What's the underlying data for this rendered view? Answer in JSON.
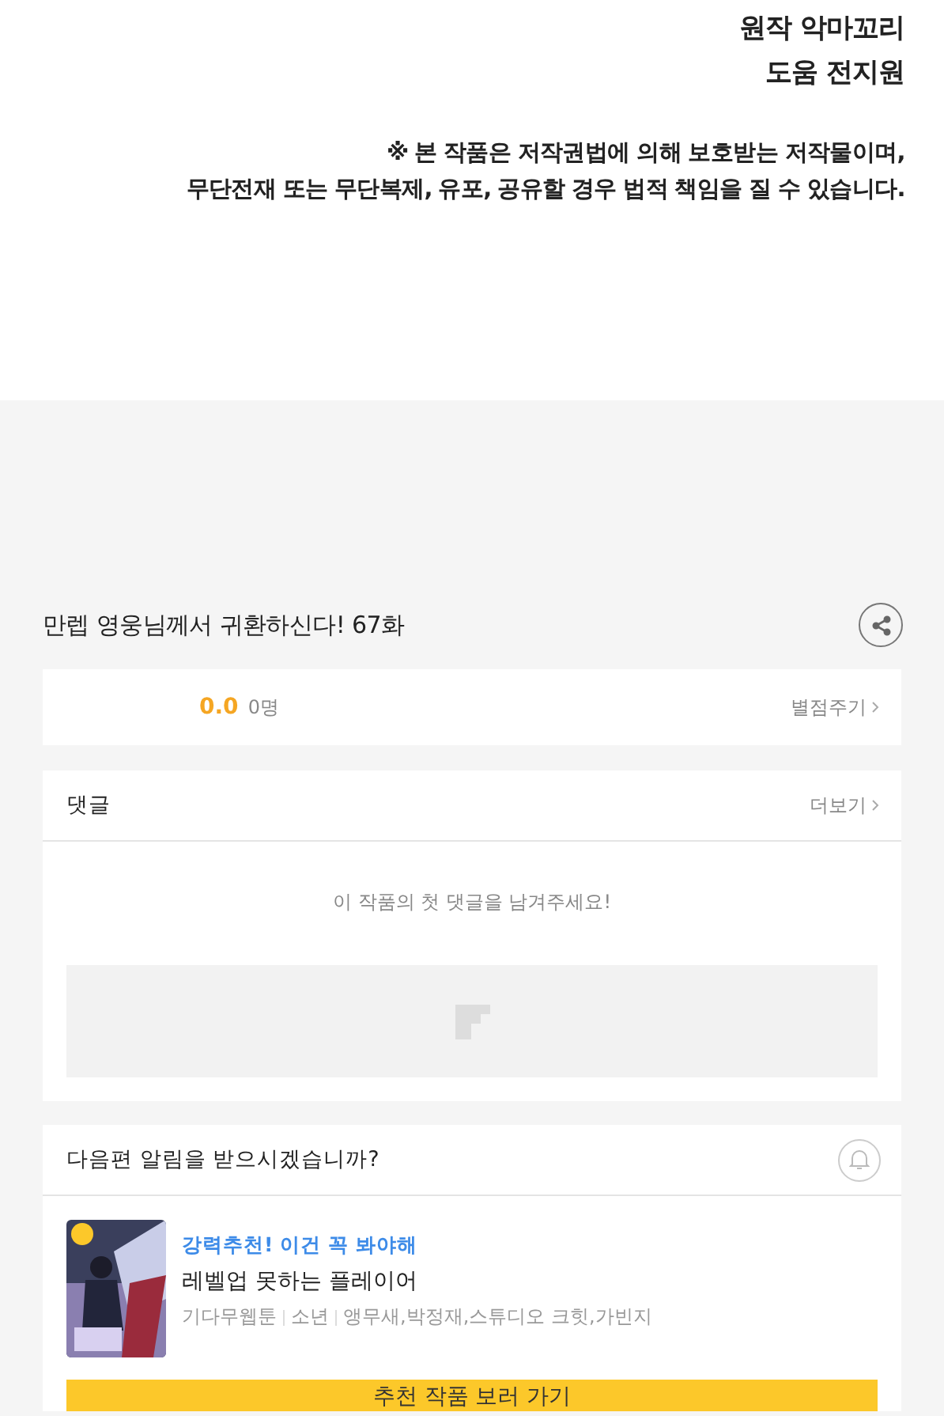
{
  "credits": [
    "원작 악마꼬리",
    "도움 전지원"
  ],
  "notice": [
    "※ 본 작품은 저작권법에 의해 보호받는 저작물이며,",
    "무단전재 또는 무단복제, 유포, 공유할 경우 법적 책임을 질 수 있습니다."
  ],
  "episode_title": "만렙 영웅님께서 귀환하신다! 67화",
  "rating": {
    "score": "0.0",
    "count": "0명",
    "action": "별점주기"
  },
  "comments": {
    "title": "댓글",
    "more": "더보기",
    "empty_message": "이 작품의 첫 댓글을 남겨주세요!"
  },
  "notify": {
    "question": "다음편 알림을 받으시겠습니까?",
    "on": false
  },
  "recommendation": {
    "tagline": "강력추천! 이건 꼭 봐야해",
    "title": "레벨업 못하는 플레이어",
    "meta": [
      "기다무웹툰",
      "소년",
      "앵무새,박정재,스튜디오 크힛,가빈지"
    ],
    "button": "추천 작품 보러 가기"
  }
}
